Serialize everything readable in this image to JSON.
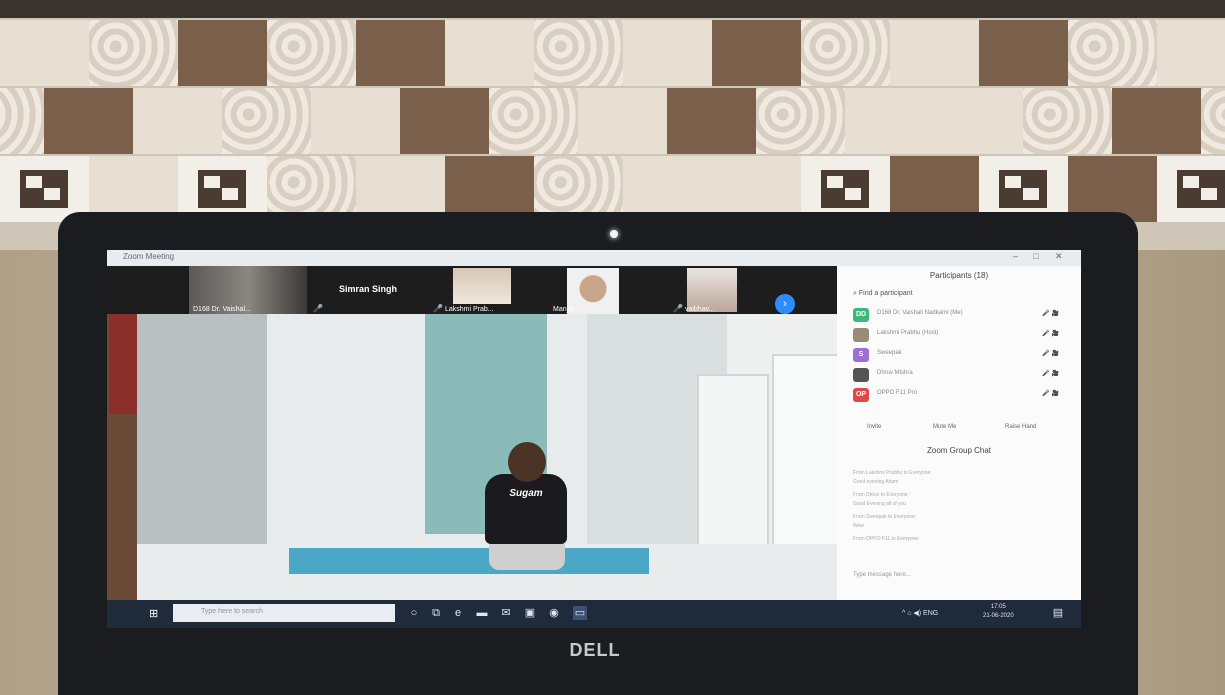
{
  "window": {
    "title": "Zoom Meeting"
  },
  "thumbnails": [
    {
      "name": "D168 Dr. Vaishal...",
      "muted": false
    },
    {
      "name": "Simran Singh",
      "muted": true
    },
    {
      "name": "Lakshmi Prab...",
      "muted": true
    },
    {
      "name": "Manjiri",
      "muted": false
    },
    {
      "name": "vaibhav...",
      "muted": true
    }
  ],
  "main_video": {
    "shirt_text": "Sugam"
  },
  "participants_panel": {
    "title": "Participants (18)",
    "find_placeholder": "Find a participant",
    "participants": [
      {
        "initials": "DD",
        "color": "#3cb878",
        "name": "D168 Dr. Vaishali Nadkarni (Me)",
        "status": "🎤 🎥"
      },
      {
        "initials": "",
        "color": "#9a8a78",
        "name": "Lakshmi Prabhu (Host)",
        "status": "🎤 🎥"
      },
      {
        "initials": "S",
        "color": "#9b6fd3",
        "name": "Sweepak",
        "status": "🎤 🎥"
      },
      {
        "initials": "",
        "color": "#555",
        "name": "Dhruv Mishra",
        "status": "🎤 🎥"
      },
      {
        "initials": "OP",
        "color": "#e04848",
        "name": "OPPO F11 Pro",
        "status": "🎤 🎥"
      }
    ],
    "buttons": [
      "Invite",
      "Mute Me",
      "Raise Hand"
    ]
  },
  "chat": {
    "title": "Zoom Group Chat",
    "messages": [
      "From Lakshmi Prabhu to Everyone:",
      "Good evening Aham",
      "From Dhruv to Everyone:",
      "Good Evening all of you",
      "From Sweepak to Everyone:",
      "Wow",
      "From OPPO F11 to Everyone:"
    ],
    "input_placeholder": "Type message here..."
  },
  "taskbar": {
    "search_placeholder": "Type here to search",
    "tray_text": "^ ⌂ ◀) ENG",
    "time": "17:05",
    "date": "21-06-2020"
  },
  "laptop": {
    "brand": "DELL"
  },
  "icons": [
    "video-camera-icon",
    "microphone-muted-icon",
    "chevron-right-icon",
    "windows-start-icon",
    "search-icon",
    "task-view-icon",
    "edge-icon",
    "folder-icon",
    "mail-icon",
    "store-icon",
    "chrome-icon",
    "zoom-icon",
    "notification-icon"
  ],
  "colors": {
    "zoom_blue": "#2d8cff",
    "taskbar": "#1f2a3a",
    "mat": "#4aa7c6"
  }
}
